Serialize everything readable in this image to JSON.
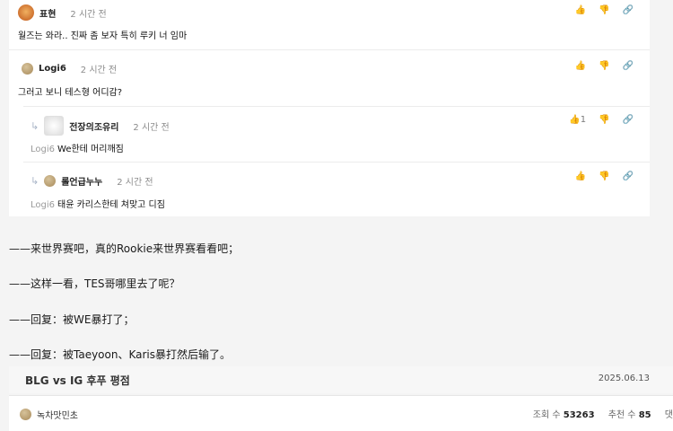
{
  "comments": [
    {
      "user": "표현",
      "time": "2 시간 전",
      "body": "월즈는 와라.. 진짜 좀 보자 특히 루키 너 임마",
      "like_count": "",
      "is_reply": false,
      "mention": ""
    },
    {
      "user": "Logi6",
      "time": "2 시간 전",
      "body": "그러고 보니 테스형 어디감?",
      "like_count": "",
      "is_reply": false,
      "mention": ""
    },
    {
      "user": "전장의조유리",
      "time": "2 시간 전",
      "body": "We한테 머리깨짐",
      "like_count": "1",
      "is_reply": true,
      "mention": "Logi6"
    },
    {
      "user": "롤언급누누",
      "time": "2 시간 전",
      "body": "태윤 카리스한테 쳐맞고 디짐",
      "like_count": "",
      "is_reply": true,
      "mention": "Logi6"
    }
  ],
  "translations": [
    "——来世界赛吧，真的Rookie来世界赛看看吧；",
    "——这样一看，TES哥哪里去了呢？",
    "——回复：被WE暴打了；",
    "——回复：被Taeyoon、Karis暴打然后输了。"
  ],
  "article": {
    "title": "BLG vs IG 후푸 평점",
    "date": "2025.06.13",
    "author": "녹차맛민초",
    "views_label": "조회 수",
    "views": "53263",
    "recommend_label": "추천 수",
    "recommend": "85",
    "trailing": "댓"
  },
  "icons": {
    "like": "thumbs-up-icon",
    "dislike": "thumbs-down-icon",
    "link": "link-icon",
    "reply": "reply-arrow-icon"
  }
}
